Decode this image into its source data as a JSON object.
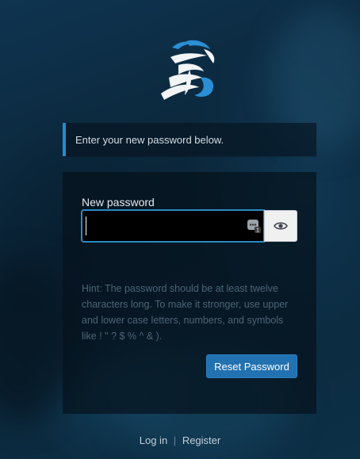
{
  "message": {
    "text": "Enter your new password below."
  },
  "form": {
    "password_label": "New password",
    "password_value": "",
    "hint": "Hint: The password should be at least twelve characters long. To make it stronger, use upper and lower case letters, numbers, and symbols like ! \" ? $ % ^ & ).",
    "submit_label": "Reset Password"
  },
  "nav": {
    "login": "Log in",
    "separator": "|",
    "register": "Register"
  },
  "icons": {
    "logo": "dragon-logo-icon",
    "password_manager": "password-manager-icon",
    "toggle_visibility": "eye-icon"
  },
  "colors": {
    "accent": "#2271b1",
    "focus_border": "#2b8ac4",
    "background": "#0b2a40"
  }
}
